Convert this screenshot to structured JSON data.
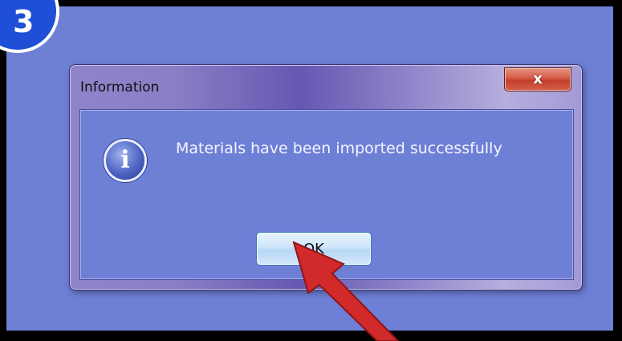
{
  "step_badge": {
    "label": "3"
  },
  "dialog": {
    "title": "Information",
    "close_label": "x",
    "message": "Materials have been imported successfully",
    "icon": "information-icon",
    "ok_label": "OK"
  },
  "annotation": {
    "type": "red-arrow-pointing-to-ok-button",
    "color": "#d22a2a"
  },
  "colors": {
    "background": "#6e7fd6",
    "badge": "#1f4fd6",
    "close_button": "#c84a34",
    "ok_button": "#cfe6fb"
  }
}
